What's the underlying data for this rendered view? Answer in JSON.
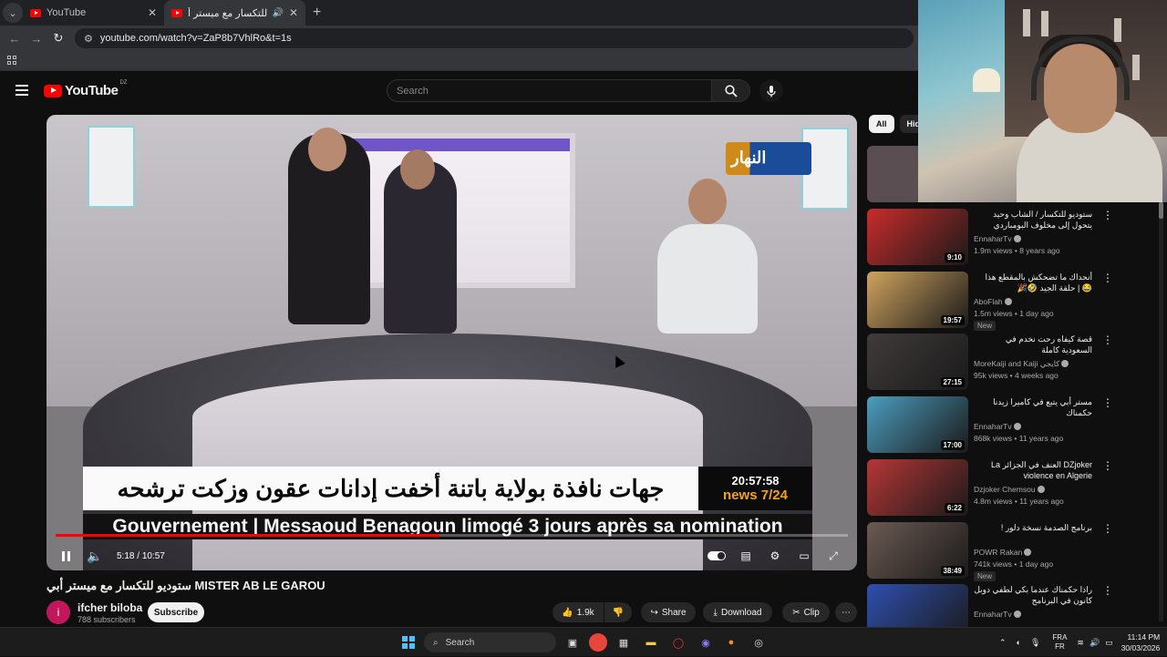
{
  "browser": {
    "tabs": [
      {
        "title": "YouTube"
      },
      {
        "title": "ستوديو للتكسار مع ميستر أ..."
      }
    ],
    "url": "youtube.com/watch?v=ZaP8b7VhlRo&t=1s"
  },
  "header": {
    "logo_text": "YouTube",
    "country_code": "DZ",
    "search_placeholder": "Search"
  },
  "player": {
    "overlay_arabic": "جهات نافذة بولاية باتنة أخفت إدانات عقون وزكت ترشحه",
    "overlay_clock": "20:57:58",
    "overlay_news": "news 7/24",
    "overlay_french": "Gouvernement | Messaoud Benagoun limogé 3 jours après sa nomination",
    "channel_logo_text": "النهار",
    "time_current": "5:18",
    "time_total": "10:57",
    "progress": 0.485
  },
  "video": {
    "title": "ستوديو للتكسار مع ميستر أبي MISTER AB LE GAROU",
    "channel_initial": "i",
    "channel_name": "ifcher biloba",
    "subscribers": "788 subscribers",
    "subscribe_label": "Subscribe",
    "likes": "1.9k",
    "share_label": "Share",
    "download_label": "Download",
    "clip_label": "Clip"
  },
  "chips": [
    {
      "label": "All"
    },
    {
      "label": "Hid"
    }
  ],
  "recommendations": [
    {
      "title": "ستوديو للتكسار / الشاب وحيد يتحول إلى مخلوف البومباردي ويهدد صحفي النهار ...",
      "channel": "EnnaharTv",
      "meta": "1.9m views • 8 years ago",
      "duration": "9:10",
      "badge": "",
      "color": "#c92b2b"
    },
    {
      "title": "أنحداك ما تضحكش بالمقطع هذا 😂 | حلقة الجيد 🤣🎉",
      "channel": "AboFlah",
      "meta": "1.5m views • 1 day ago",
      "duration": "19:57",
      "badge": "New",
      "color": "#cfa35e"
    },
    {
      "title": "قصة كيفاه رحت نخدم في السعودية كاملة",
      "channel": "MoreKaiji and Kaiji كايجي",
      "meta": "95k views • 4 weeks ago",
      "duration": "27:15",
      "badge": "",
      "color": "#3f3b3a"
    },
    {
      "title": "مستر أبي يتبع في كاميرا زيدنا حكمناك",
      "channel": "EnnaharTv",
      "meta": "868k views • 11 years ago",
      "duration": "17:00",
      "badge": "",
      "color": "#4c9dbf"
    },
    {
      "title": "DZjoker العنف في الجزائر La violence en Algerie",
      "channel": "Dzjoker Chemsou",
      "meta": "4.8m views • 11 years ago",
      "duration": "6:22",
      "badge": "",
      "color": "#b73636"
    },
    {
      "title": "برنامج الصدمة نسخة دلور !",
      "channel": "POWR Rakan",
      "meta": "741k views • 1 day ago",
      "duration": "38:49",
      "badge": "New",
      "color": "#6b5a52"
    },
    {
      "title": "راذا حكمناك عندما بكي لطفي دوبل كانون في البرنامج",
      "channel": "EnnaharTv",
      "meta": "",
      "duration": "",
      "badge": "",
      "color": "#2f4fb0"
    }
  ],
  "taskbar": {
    "search_label": "Search",
    "lang_top": "FRA",
    "lang_bottom": "FR",
    "time": "11:14 PM",
    "date": "30/03/2026"
  }
}
